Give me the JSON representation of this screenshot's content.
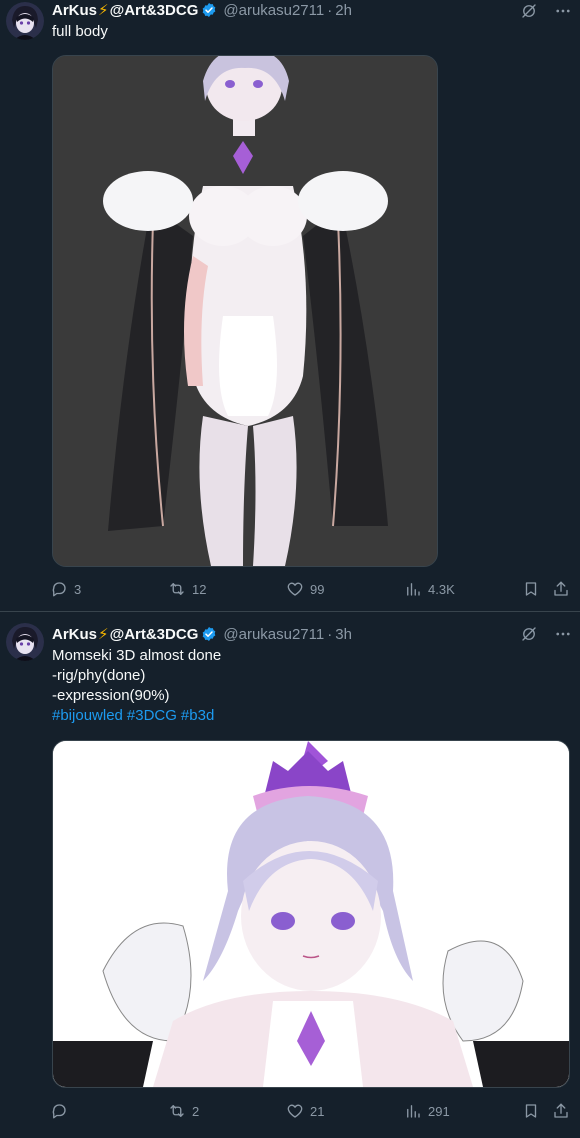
{
  "tweets": [
    {
      "author": {
        "name": "ArKus",
        "bolt": "⚡",
        "name_suffix": "@Art&3DCG",
        "handle": "@arukasu2711",
        "time": "2h"
      },
      "text": [
        "full body"
      ],
      "hashtags": [],
      "media": {
        "description_icon": "3d-character-full-body-image",
        "background": "#3a3a3a"
      },
      "actions": {
        "replies": "3",
        "retweets": "12",
        "likes": "99",
        "views": "4.3K"
      }
    },
    {
      "author": {
        "name": "ArKus",
        "bolt": "⚡",
        "name_suffix": "@Art&3DCG",
        "handle": "@arukasu2711",
        "time": "3h"
      },
      "text": [
        "Momseki 3D almost done",
        "-rig/phy(done)",
        "-expression(90%)"
      ],
      "hashtags": [
        "#bijouwled",
        "#3DCG",
        "#b3d"
      ],
      "media": {
        "description_icon": "3d-character-portrait-image",
        "background": "#ffffff"
      },
      "actions": {
        "replies": "",
        "retweets": "2",
        "likes": "21",
        "views": "291"
      }
    }
  ],
  "colors": {
    "background": "#15202b",
    "text": "#f7f9f9",
    "secondary": "#8b98a5",
    "link": "#1d9bf0",
    "verified": "#1d9bf0",
    "border": "#38444d"
  },
  "separator": "·"
}
